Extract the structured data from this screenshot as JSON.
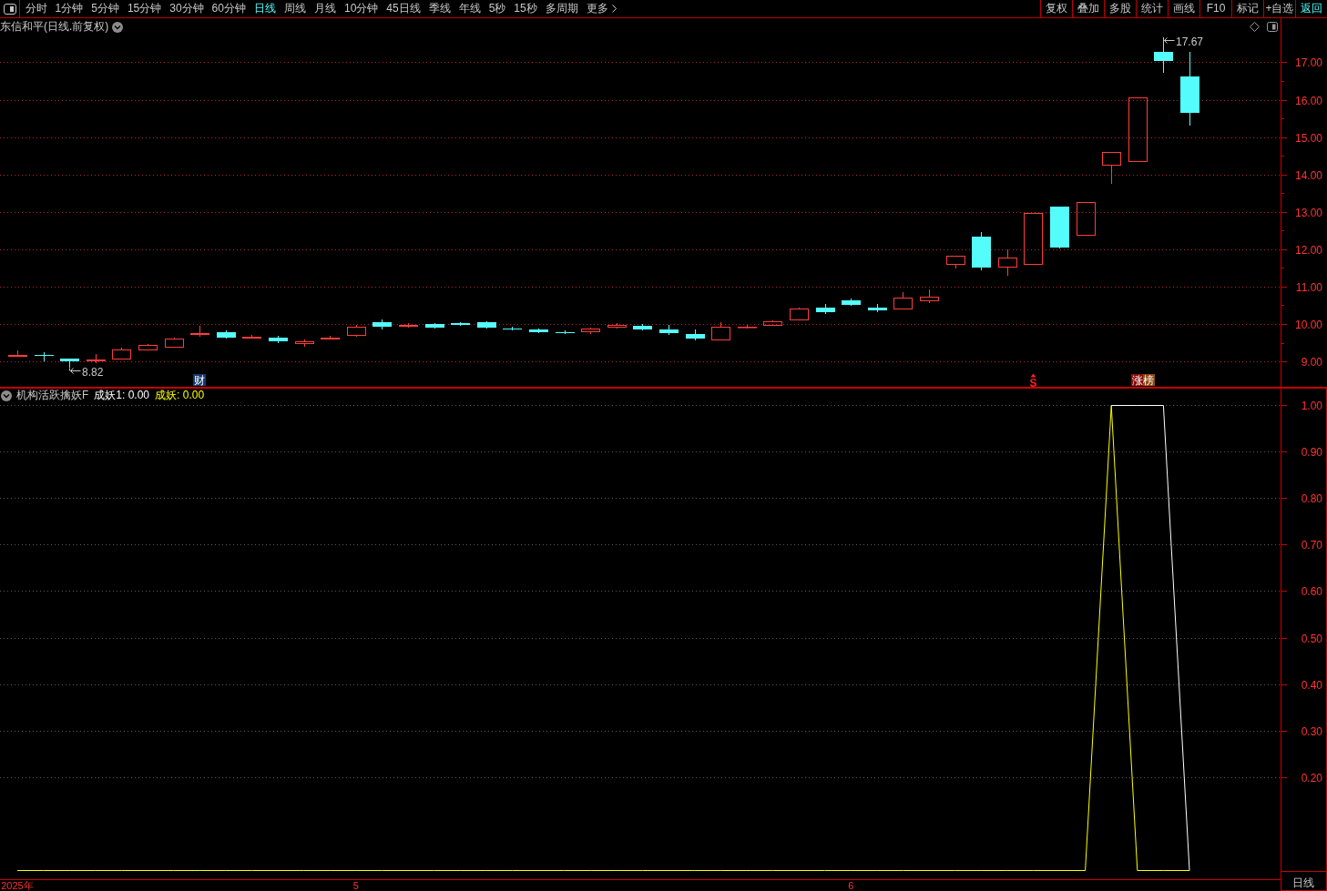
{
  "toolbar": {
    "periods": [
      {
        "label": "分时",
        "selected": false
      },
      {
        "label": "1分钟",
        "selected": false
      },
      {
        "label": "5分钟",
        "selected": false
      },
      {
        "label": "15分钟",
        "selected": false
      },
      {
        "label": "30分钟",
        "selected": false
      },
      {
        "label": "60分钟",
        "selected": false
      },
      {
        "label": "日线",
        "selected": true
      },
      {
        "label": "周线",
        "selected": false
      },
      {
        "label": "月线",
        "selected": false
      },
      {
        "label": "10分钟",
        "selected": false
      },
      {
        "label": "45日线",
        "selected": false
      },
      {
        "label": "季线",
        "selected": false
      },
      {
        "label": "年线",
        "selected": false
      },
      {
        "label": "5秒",
        "selected": false
      },
      {
        "label": "15秒",
        "selected": false
      },
      {
        "label": "多周期",
        "selected": false
      }
    ],
    "more": {
      "label": "更多"
    },
    "tools": [
      {
        "label": "复权",
        "kind": "tool"
      },
      {
        "label": "叠加",
        "kind": "tool"
      },
      {
        "label": "多股",
        "kind": "tool"
      },
      {
        "label": "统计",
        "kind": "tool"
      },
      {
        "label": "画线",
        "kind": "tool"
      },
      {
        "label": "F10",
        "kind": "tool"
      },
      {
        "label": "标记",
        "kind": "tool"
      },
      {
        "label": "+自选",
        "kind": "tool"
      },
      {
        "label": "返回",
        "kind": "back"
      }
    ]
  },
  "price_panel": {
    "title": "东信和平(日线.前复权)",
    "chart_data": {
      "type": "candlestick",
      "categories": [
        null,
        null,
        null,
        null,
        null,
        null,
        null,
        null,
        null,
        null,
        null,
        null,
        null,
        null,
        null,
        null,
        null,
        null,
        null,
        null,
        null,
        null,
        null,
        null,
        null,
        null,
        null,
        null,
        null,
        null,
        null,
        null,
        null,
        null,
        null,
        null,
        null,
        null,
        null,
        null,
        null,
        null,
        null,
        null,
        null,
        null,
        null,
        null,
        null
      ],
      "ylim": [
        8.32,
        18.18
      ],
      "grid": true,
      "yticks": [
        {
          "value": 17,
          "label": "17.00"
        },
        {
          "value": 16,
          "label": "16.00"
        },
        {
          "value": 15,
          "label": "15.00"
        },
        {
          "value": 14,
          "label": "14.00"
        },
        {
          "value": 13,
          "label": "13.00"
        },
        {
          "value": 12,
          "label": "12.00"
        },
        {
          "value": 11,
          "label": "11.00"
        },
        {
          "value": 10,
          "label": "10.00"
        },
        {
          "value": 9,
          "label": "9.00"
        }
      ],
      "annotations": [
        "8.82",
        "17.67"
      ]
    },
    "event_markers": [
      {
        "label": "财",
        "kind": "finance"
      },
      {
        "label": "S",
        "kind": "signal"
      },
      {
        "label": "涨榜",
        "kind": "rank"
      }
    ]
  },
  "indicator_panel": {
    "name": "机构活跃擒妖F",
    "legend": [
      {
        "label": "成妖1: 0.00",
        "color": "#ffffff"
      },
      {
        "label": "成妖: 0.00",
        "color": "#ffff00"
      }
    ],
    "chart_data": {
      "type": "line",
      "categories": [
        "2025年",
        null,
        null,
        null,
        null,
        null,
        null,
        null,
        null,
        null,
        null,
        null,
        null,
        "5",
        null,
        null,
        null,
        null,
        null,
        null,
        null,
        null,
        null,
        null,
        null,
        null,
        null,
        null,
        null,
        null,
        null,
        null,
        "6",
        null,
        null,
        null,
        null,
        null,
        null,
        null,
        null,
        null,
        null,
        null,
        null,
        null,
        null,
        null,
        null
      ],
      "series": [
        {
          "color": "#ffffff",
          "values": [
            null,
            null,
            null,
            null,
            null,
            null,
            null,
            null,
            null,
            null,
            null,
            null,
            null,
            null,
            null,
            null,
            null,
            null,
            null,
            null,
            null,
            null,
            null,
            null,
            null,
            null,
            null,
            null,
            null,
            null,
            null,
            null,
            null,
            null,
            null,
            null,
            null,
            null,
            null,
            null,
            null,
            null,
            1,
            1,
            1,
            0,
            null,
            null,
            null
          ]
        },
        {
          "color": "#ffff00",
          "values": [
            0,
            0,
            0,
            0,
            0,
            0,
            0,
            0,
            0,
            0,
            0,
            0,
            0,
            0,
            0,
            0,
            0,
            0,
            0,
            0,
            0,
            0,
            0,
            0,
            0,
            0,
            0,
            0,
            0,
            0,
            0,
            0,
            0,
            0,
            0,
            0,
            0,
            0,
            0,
            0,
            0,
            0,
            1,
            0,
            0,
            0,
            null,
            null,
            null
          ]
        }
      ],
      "ylim": [
        -0.019,
        1.037
      ],
      "grid": true,
      "yticks": [
        {
          "value": 1.0,
          "label": "1.00"
        },
        {
          "value": 0.9,
          "label": "0.90"
        },
        {
          "value": 0.8,
          "label": "0.80"
        },
        {
          "value": 0.7,
          "label": "0.70"
        },
        {
          "value": 0.6,
          "label": "0.60"
        },
        {
          "value": 0.5,
          "label": "0.50"
        },
        {
          "value": 0.4,
          "label": "0.40"
        },
        {
          "value": 0.3,
          "label": "0.30"
        },
        {
          "value": 0.2,
          "label": "0.20"
        }
      ]
    }
  },
  "period_label": "日线"
}
